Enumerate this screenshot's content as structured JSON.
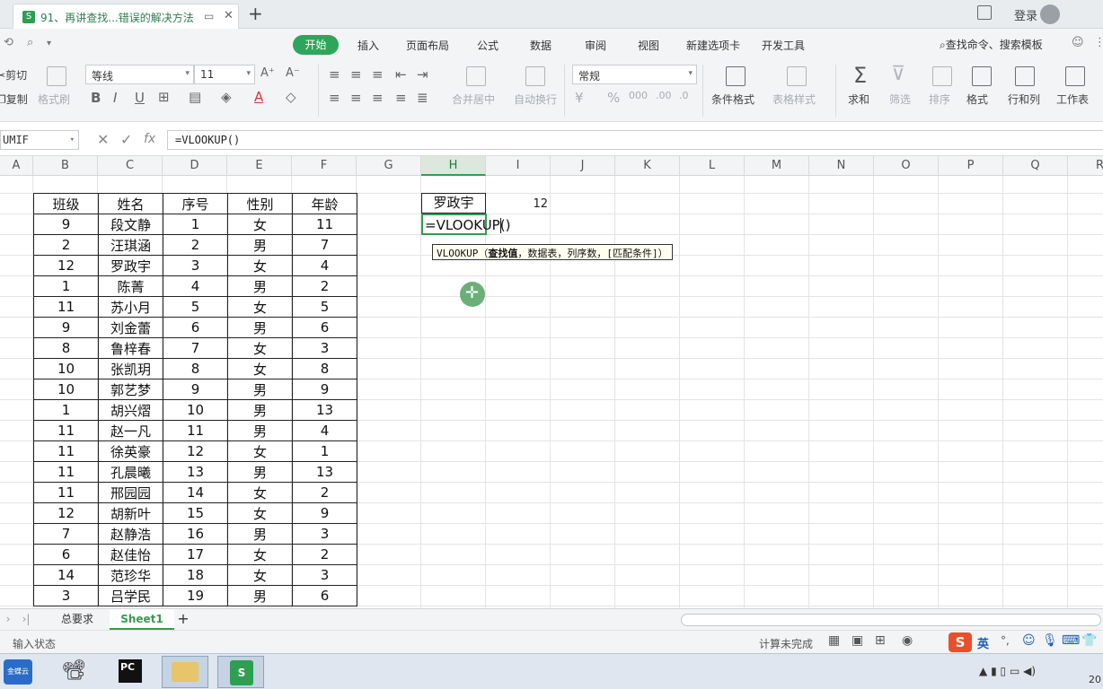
{
  "titlebar": {
    "doc_tab": "91、再讲查找...错误的解决方法",
    "new_tab": "+",
    "login": "登录"
  },
  "menu": {
    "items": [
      "开始",
      "插入",
      "页面布局",
      "公式",
      "数据",
      "审阅",
      "视图",
      "新建选项卡",
      "开发工具"
    ],
    "active": "开始",
    "search": "查找命令、搜索模板"
  },
  "ribbon": {
    "cut": "剪切",
    "copy": "复制",
    "format_painter": "格式刷",
    "font_name": "等线",
    "font_size": "11",
    "merge_center": "合并居中",
    "wrap_text": "自动换行",
    "number_format": "常规",
    "conditional_format": "条件格式",
    "table_style": "表格样式",
    "sum": "求和",
    "filter": "筛选",
    "sort": "排序",
    "format": "格式",
    "rows_cols": "行和列",
    "worksheet": "工作表"
  },
  "formulabar": {
    "name_box": "UMIF",
    "fx": "fx",
    "formula": "=VLOOKUP()"
  },
  "columns": [
    "A",
    "B",
    "C",
    "D",
    "E",
    "F",
    "G",
    "H",
    "I",
    "J",
    "K",
    "L",
    "M",
    "N",
    "O",
    "P",
    "Q",
    "R"
  ],
  "table": {
    "headers": [
      "班级",
      "姓名",
      "序号",
      "性别",
      "年龄"
    ],
    "rows": [
      [
        "9",
        "段文静",
        "1",
        "女",
        "11"
      ],
      [
        "2",
        "汪琪涵",
        "2",
        "男",
        "7"
      ],
      [
        "12",
        "罗政宇",
        "3",
        "女",
        "4"
      ],
      [
        "1",
        "陈菁",
        "4",
        "男",
        "2"
      ],
      [
        "11",
        "苏小月",
        "5",
        "女",
        "5"
      ],
      [
        "9",
        "刘金蕾",
        "6",
        "男",
        "6"
      ],
      [
        "8",
        "鲁梓春",
        "7",
        "女",
        "3"
      ],
      [
        "10",
        "张凯玥",
        "8",
        "女",
        "8"
      ],
      [
        "10",
        "郭艺梦",
        "9",
        "男",
        "9"
      ],
      [
        "1",
        "胡兴熠",
        "10",
        "男",
        "13"
      ],
      [
        "11",
        "赵一凡",
        "11",
        "男",
        "4"
      ],
      [
        "11",
        "徐英豪",
        "12",
        "女",
        "1"
      ],
      [
        "11",
        "孔晨曦",
        "13",
        "男",
        "13"
      ],
      [
        "11",
        "邢园园",
        "14",
        "女",
        "2"
      ],
      [
        "12",
        "胡新叶",
        "15",
        "女",
        "9"
      ],
      [
        "7",
        "赵静浩",
        "16",
        "男",
        "3"
      ],
      [
        "6",
        "赵佳怡",
        "17",
        "女",
        "2"
      ],
      [
        "14",
        "范珍华",
        "18",
        "女",
        "3"
      ],
      [
        "3",
        "吕学民",
        "19",
        "男",
        "6"
      ]
    ]
  },
  "lookup": {
    "name": "罗政宇",
    "value": "12",
    "active_cell_text": "=VLOOKUP()",
    "tooltip_fn": "VLOOKUP（",
    "tooltip_bold": "查找值",
    "tooltip_rest": "，数据表，列序数，[匹配条件]）"
  },
  "sheets": {
    "tabs": [
      "总要求",
      "Sheet1"
    ],
    "active": "Sheet1",
    "add": "+"
  },
  "status": {
    "mode": "输入状态",
    "calc": "计算未完成",
    "ime_lang": "英"
  },
  "taskbar": {
    "start": "金蝶云",
    "clock": "20"
  },
  "colors": {
    "accent": "#2e9e52",
    "active_cell_border": "#2e9e52",
    "tooltip_bg": "#fffff0"
  }
}
